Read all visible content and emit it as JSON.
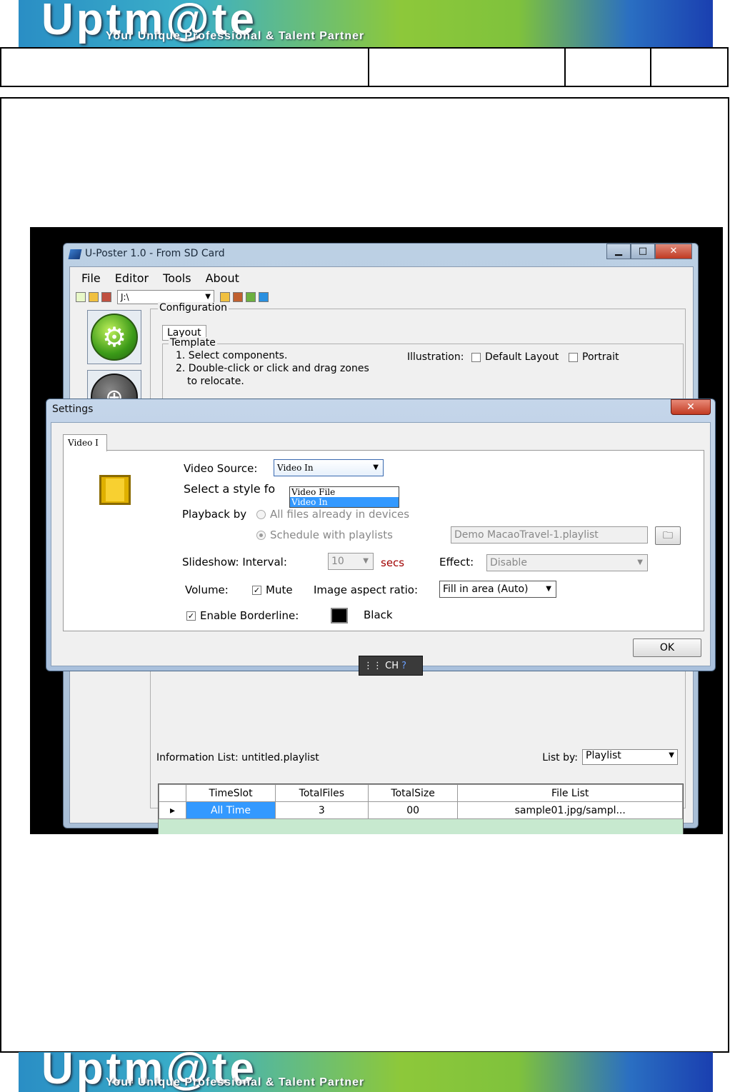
{
  "banner": {
    "logo": "Uptm@te",
    "tagline": "Your Unique Professional & Talent Partner"
  },
  "main_window": {
    "title": "U-Poster 1.0 - From SD Card",
    "menu": [
      "File",
      "Editor",
      "Tools",
      "About"
    ],
    "drive": "J:\\",
    "configuration": {
      "legend": "Configuration",
      "tab": "Layout",
      "template_legend": "Template",
      "steps": [
        "1. Select components.",
        "2. Double-click or click and drag zones",
        "to relocate."
      ],
      "illustration_label": "Illustration:",
      "default_layout": "Default Layout",
      "portrait": "Portrait"
    },
    "info_list_label": "Information List:",
    "info_list_value": "untitled.playlist",
    "list_by_label": "List by:",
    "list_by_value": "Playlist",
    "grid": {
      "columns": [
        "TimeSlot",
        "TotalFiles",
        "TotalSize",
        "File List"
      ],
      "rows": [
        [
          "All Time",
          "3",
          "00",
          "sample01.jpg/sampl..."
        ]
      ]
    }
  },
  "settings": {
    "title": "Settings",
    "tab": "Video I",
    "video_source_label": "Video Source:",
    "video_source_value": "Video In",
    "video_source_options": [
      "Video File",
      "Video In"
    ],
    "select_style_label": "Select a style fo",
    "playback_label": "Playback by",
    "playback_opt1": "All files already in devices",
    "playback_opt2": "Schedule with playlists",
    "playlist_value": "Demo MacaoTravel-1.playlist",
    "slideshow_label": "Slideshow: Interval:",
    "interval_value": "10",
    "secs": "secs",
    "effect_label": "Effect:",
    "effect_value": "Disable",
    "volume_label": "Volume:",
    "mute_label": "Mute",
    "aspect_label": "Image aspect ratio:",
    "aspect_value": "Fill in area (Auto)",
    "border_label": "Enable Borderline:",
    "border_color_name": "Black",
    "ok": "OK",
    "close": "✕"
  },
  "ime": {
    "text": "CH"
  },
  "colors": {
    "selection": "#3399ff",
    "grid_bg": "#c7e9cf",
    "secs": "#a00000"
  }
}
